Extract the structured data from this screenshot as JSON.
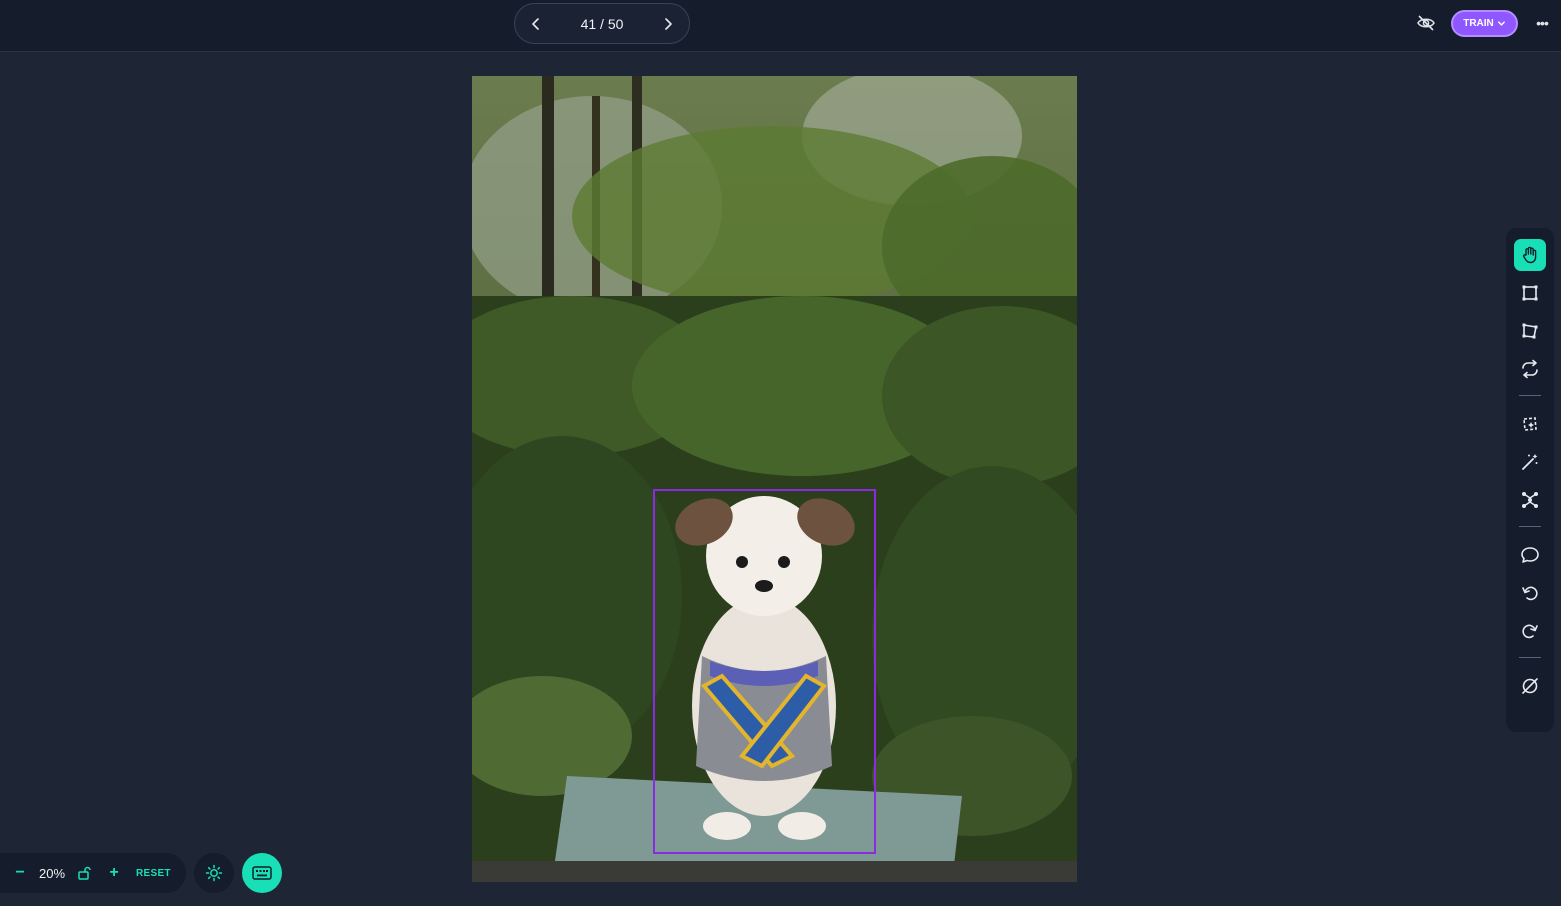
{
  "pager": {
    "current": "41",
    "total": "50",
    "label": "41 / 50"
  },
  "header": {
    "train_label": "TRAIN",
    "more_label": "•••"
  },
  "zoom": {
    "minus": "−",
    "value": "20%",
    "plus": "+",
    "reset_label": "RESET"
  },
  "toolbar": {
    "tools": [
      "hand-icon",
      "bounding-box-icon",
      "polygon-icon",
      "repeat-icon",
      "smart-polygon-icon",
      "magic-wand-icon",
      "keypoints-icon",
      "comment-icon",
      "undo-icon",
      "redo-icon",
      "null-icon"
    ]
  },
  "colors": {
    "accent": "#19dfb6",
    "train": "#8f57ff",
    "bbox": "#8a2be2",
    "background": "#1e2636",
    "panel": "#151c2b"
  }
}
